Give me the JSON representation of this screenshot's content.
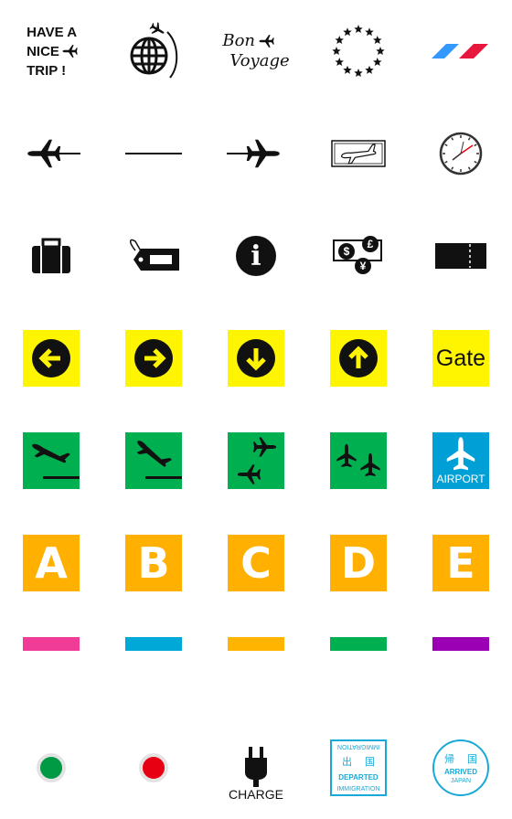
{
  "stickers": {
    "have_nice_trip": {
      "line1": "HAVE A",
      "line2": "NICE",
      "line3": "TRIP !"
    },
    "bon_voyage": {
      "line1": "Bon",
      "line2": "Voyage"
    },
    "info": {
      "glyph": "i"
    },
    "currency": {
      "dollar": "$",
      "pound": "£",
      "yen": "¥"
    },
    "gate": {
      "label": "Gate"
    },
    "airport": {
      "label": "AIRPORT"
    },
    "letters": [
      "A",
      "B",
      "C",
      "D",
      "E"
    ],
    "charge": {
      "label": "CHARGE"
    },
    "departed_stamp": {
      "top": "IMMIGRATION",
      "kanji1": "出",
      "kanji2": "国",
      "label": "DEPARTED",
      "bottom": "IMMIGRATION"
    },
    "arrived_stamp": {
      "kanji1": "帰",
      "kanji2": "国",
      "label": "ARRIVED",
      "bottom": "JAPAN"
    }
  },
  "colors": {
    "yellow": "#fff500",
    "green": "#00b050",
    "airport_blue": "#00a0d6",
    "orange": "#ffb000",
    "flag_blue": "#3399ff",
    "flag_red": "#e8173c",
    "stamp_blue": "#1aa9d6",
    "bars": [
      "#f03c96",
      "#00a8d8",
      "#ffb400",
      "#00b050",
      "#9b00b4"
    ],
    "dot_green": "#009a44",
    "dot_red": "#e60012"
  }
}
